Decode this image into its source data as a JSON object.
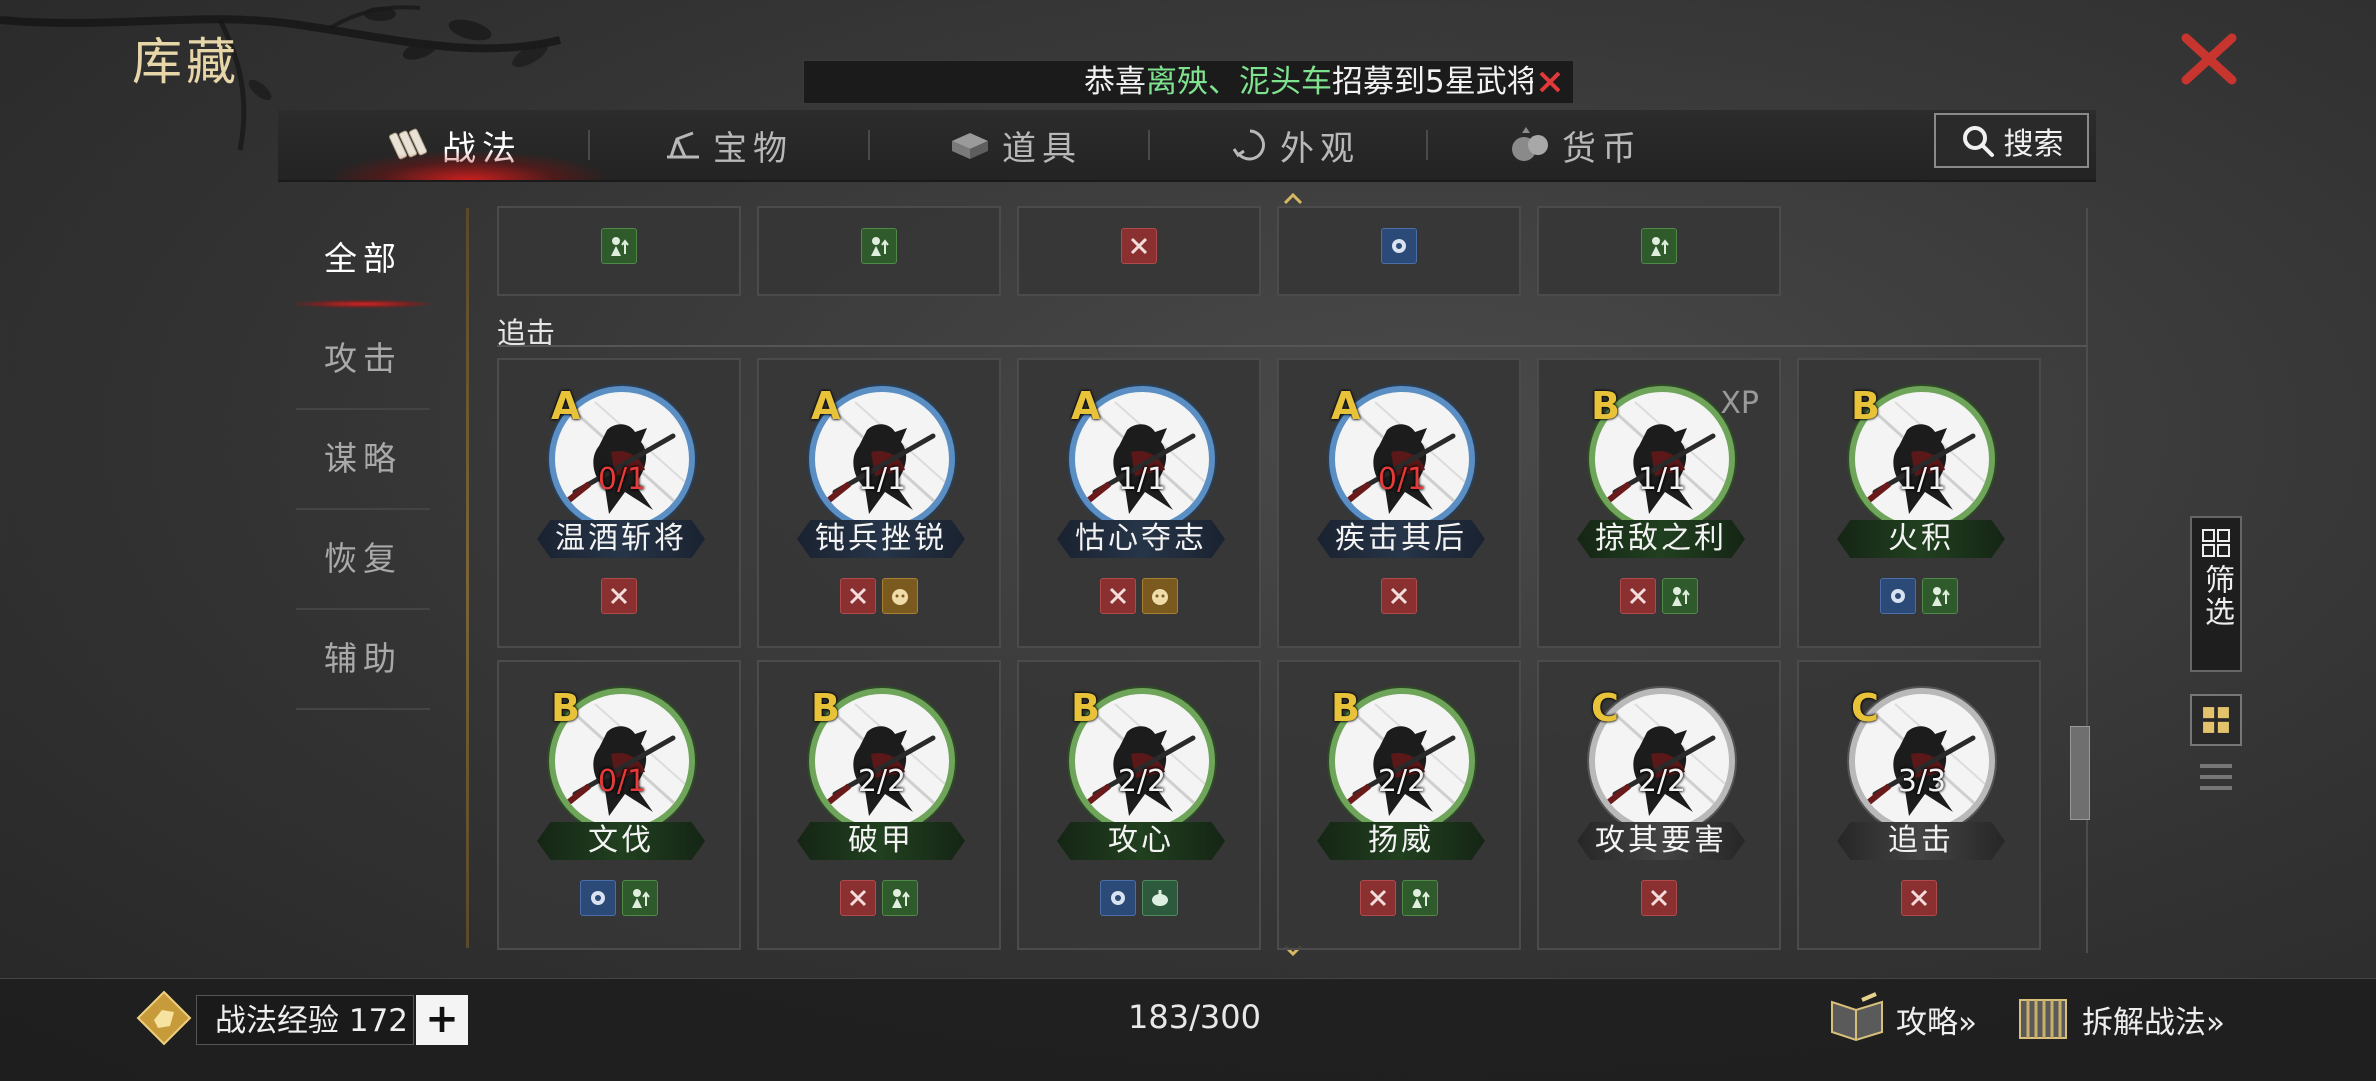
{
  "header": {
    "title": "库藏",
    "announcement": {
      "prefix": "恭喜",
      "player1": "离殃",
      "separator": "、",
      "player2": "泥头车",
      "suffix": "招募到5星武将"
    }
  },
  "tabs": [
    {
      "label": "战法",
      "icon": "tactics-scroll-icon",
      "active": true
    },
    {
      "label": "宝物",
      "icon": "treasure-icon",
      "active": false
    },
    {
      "label": "道具",
      "icon": "items-icon",
      "active": false
    },
    {
      "label": "外观",
      "icon": "appearance-icon",
      "active": false
    },
    {
      "label": "货币",
      "icon": "currency-icon",
      "active": false
    }
  ],
  "search": {
    "label": "搜索"
  },
  "categories": [
    {
      "label": "全部",
      "active": true
    },
    {
      "label": "攻击",
      "active": false
    },
    {
      "label": "谋略",
      "active": false
    },
    {
      "label": "恢复",
      "active": false
    },
    {
      "label": "辅助",
      "active": false
    }
  ],
  "partial_row_tags": [
    "counter",
    "counter",
    "attack",
    "shield",
    "counter"
  ],
  "section": {
    "label": "追击"
  },
  "cards": [
    {
      "grade": "A",
      "count": "0/1",
      "zero": true,
      "name": "温酒斩将",
      "tags": [
        "attack"
      ]
    },
    {
      "grade": "A",
      "count": "1/1",
      "zero": false,
      "name": "钝兵挫锐",
      "tags": [
        "attack",
        "beast"
      ]
    },
    {
      "grade": "A",
      "count": "1/1",
      "zero": false,
      "name": "怙心夺志",
      "tags": [
        "attack",
        "beast"
      ]
    },
    {
      "grade": "A",
      "count": "0/1",
      "zero": true,
      "name": "疾击其后",
      "tags": [
        "attack"
      ]
    },
    {
      "grade": "B",
      "count": "1/1",
      "zero": false,
      "name": "掠敌之利",
      "tags": [
        "attack",
        "counter"
      ],
      "xp": "XP"
    },
    {
      "grade": "B",
      "count": "1/1",
      "zero": false,
      "name": "火积",
      "tags": [
        "shield",
        "counter"
      ]
    },
    {
      "grade": "B",
      "count": "0/1",
      "zero": true,
      "name": "文伐",
      "tags": [
        "shield",
        "counter"
      ]
    },
    {
      "grade": "B",
      "count": "2/2",
      "zero": false,
      "name": "破甲",
      "tags": [
        "attack",
        "counter"
      ]
    },
    {
      "grade": "B",
      "count": "2/2",
      "zero": false,
      "name": "攻心",
      "tags": [
        "shield",
        "heal"
      ]
    },
    {
      "grade": "B",
      "count": "2/2",
      "zero": false,
      "name": "扬威",
      "tags": [
        "attack",
        "counter"
      ]
    },
    {
      "grade": "C",
      "count": "2/2",
      "zero": false,
      "name": "攻其要害",
      "tags": [
        "attack"
      ]
    },
    {
      "grade": "C",
      "count": "3/3",
      "zero": false,
      "name": "追击",
      "tags": [
        "attack"
      ]
    }
  ],
  "filter": {
    "label": "筛选"
  },
  "bottom": {
    "exp_label": "战法经验 172",
    "plus": "+",
    "capacity": "183/300",
    "guide": "攻略»",
    "dismantle": "拆解战法»"
  },
  "colors": {
    "accent_gold": "#e7d6a8",
    "close_red": "#c8352f",
    "highlight_green": "#7fe28f",
    "grade_gold": "#e8c33a",
    "ring_A": "#5b8fc4",
    "ring_B": "#6fa55a",
    "ring_C": "#b9b9b9"
  }
}
